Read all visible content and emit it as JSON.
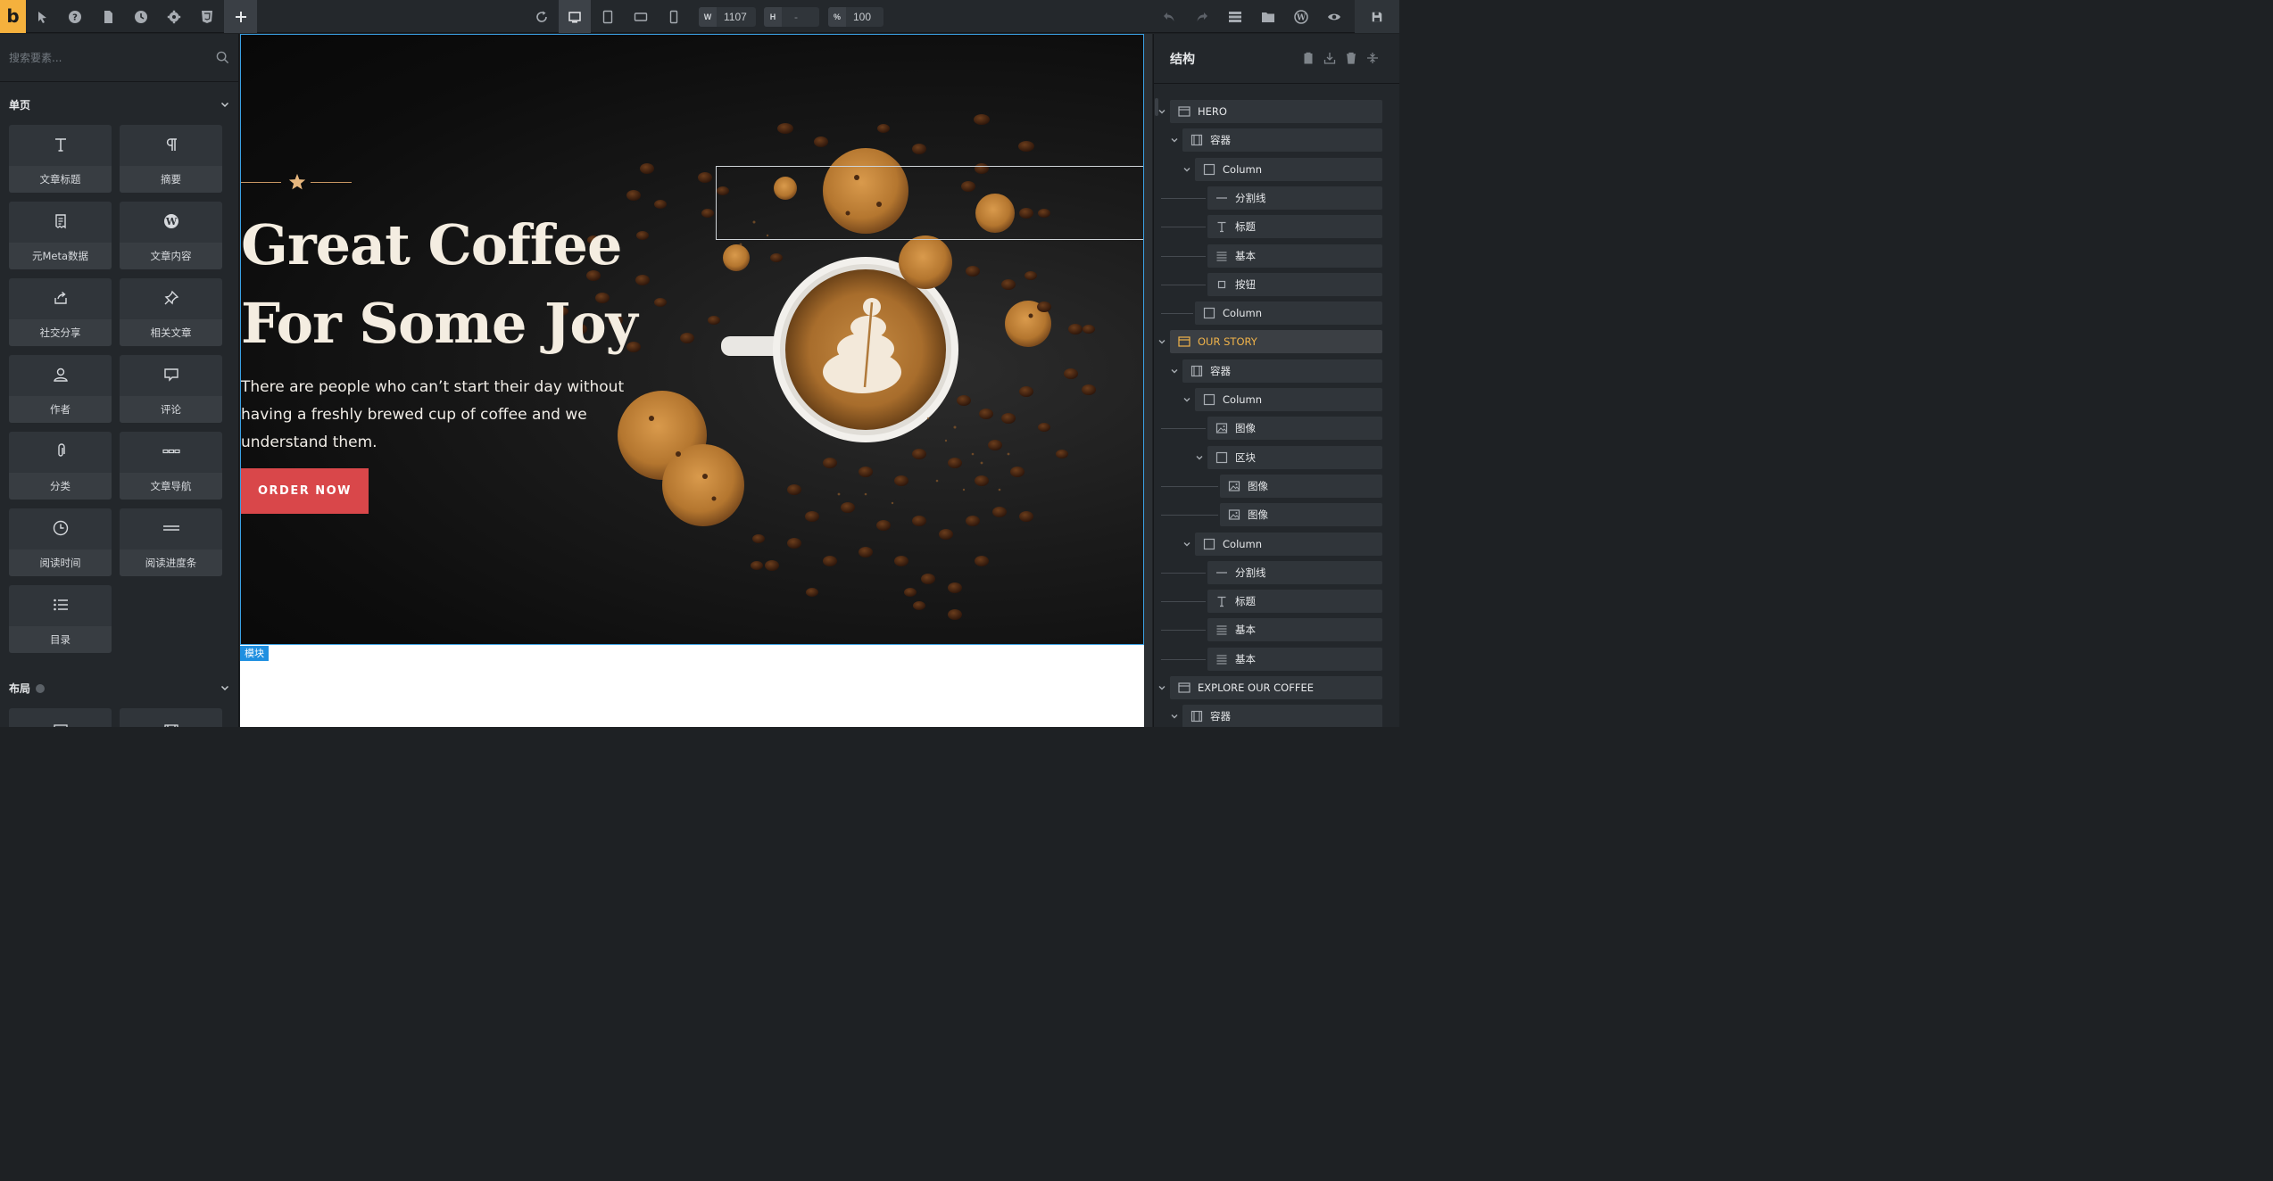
{
  "toolbar": {
    "logo": "b",
    "width_label": "W",
    "width_value": "1107",
    "height_label": "H",
    "height_value": "-",
    "zoom_label": "%",
    "zoom_value": "100"
  },
  "left_panel": {
    "search_placeholder": "搜索要素...",
    "section_single": "单页",
    "section_layout": "布局",
    "elements": [
      {
        "label": "文章标题",
        "icon": "text-t-icon"
      },
      {
        "label": "摘要",
        "icon": "paragraph-icon"
      },
      {
        "label": "元Meta数据",
        "icon": "receipt-icon"
      },
      {
        "label": "文章内容",
        "icon": "wordpress-icon"
      },
      {
        "label": "社交分享",
        "icon": "share-icon"
      },
      {
        "label": "相关文章",
        "icon": "pin-icon"
      },
      {
        "label": "作者",
        "icon": "user-icon"
      },
      {
        "label": "评论",
        "icon": "comment-icon"
      },
      {
        "label": "分类",
        "icon": "paperclip-icon"
      },
      {
        "label": "文章导航",
        "icon": "dots-nav-icon"
      },
      {
        "label": "阅读时间",
        "icon": "clock-icon"
      },
      {
        "label": "阅读进度条",
        "icon": "bars-icon"
      },
      {
        "label": "目录",
        "icon": "list-icon"
      }
    ]
  },
  "canvas": {
    "hero_title_line1": "Great Coffee",
    "hero_title_line2": "For Some Joy",
    "hero_text": "There are people who can’t start their day without having a freshly brewed cup of coffee and we understand them.",
    "order_button": "ORDER NOW",
    "module_tag": "模块"
  },
  "right_panel": {
    "title": "结构",
    "tree": [
      {
        "label": "HERO",
        "icon": "section-icon",
        "highlight": false
      },
      {
        "label": "容器",
        "icon": "container-icon",
        "highlight": false
      },
      {
        "label": "Column",
        "icon": "column-icon",
        "highlight": false
      },
      {
        "label": "分割线",
        "icon": "divider-icon",
        "highlight": false
      },
      {
        "label": "标题",
        "icon": "heading-icon",
        "highlight": false
      },
      {
        "label": "基本",
        "icon": "text-basic-icon",
        "highlight": false
      },
      {
        "label": "按钮",
        "icon": "button-icon",
        "highlight": false
      },
      {
        "label": "Column",
        "icon": "column-icon",
        "highlight": false
      },
      {
        "label": "OUR STORY",
        "icon": "section-icon",
        "highlight": true
      },
      {
        "label": "容器",
        "icon": "container-icon",
        "highlight": false
      },
      {
        "label": "Column",
        "icon": "column-icon",
        "highlight": false
      },
      {
        "label": "图像",
        "icon": "image-icon",
        "highlight": false
      },
      {
        "label": "区块",
        "icon": "block-icon",
        "highlight": false
      },
      {
        "label": "图像",
        "icon": "image-icon",
        "highlight": false
      },
      {
        "label": "图像",
        "icon": "image-icon",
        "highlight": false
      },
      {
        "label": "Column",
        "icon": "column-icon",
        "highlight": false
      },
      {
        "label": "分割线",
        "icon": "divider-icon",
        "highlight": false
      },
      {
        "label": "标题",
        "icon": "heading-icon",
        "highlight": false
      },
      {
        "label": "基本",
        "icon": "text-basic-icon",
        "highlight": false
      },
      {
        "label": "基本",
        "icon": "text-basic-icon",
        "highlight": false
      },
      {
        "label": "EXPLORE OUR COFFEE",
        "icon": "section-icon",
        "highlight": false
      },
      {
        "label": "容器",
        "icon": "container-icon",
        "highlight": false
      }
    ]
  },
  "colors": {
    "accent": "#f5b13d",
    "order_button": "#d9474a",
    "selection": "#3aa0e3",
    "tree_highlight": "#f0b34a"
  }
}
